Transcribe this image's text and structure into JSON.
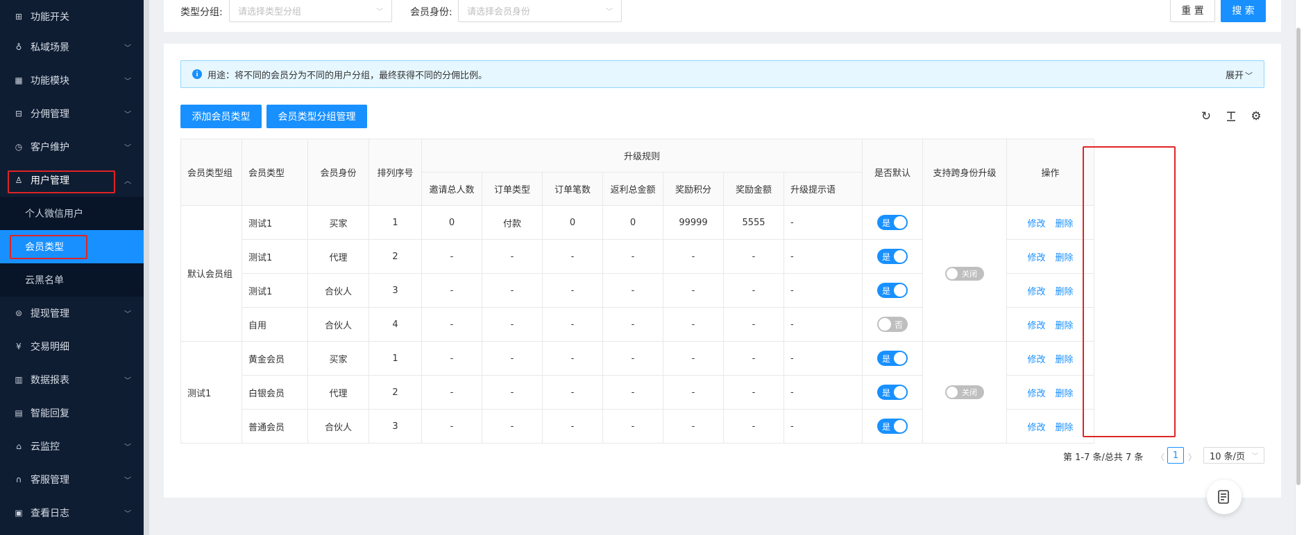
{
  "sidebar": {
    "menu": [
      {
        "label": "功能开关",
        "icon": "grid-icon",
        "chevron": false
      },
      {
        "label": "私域场景",
        "icon": "cup-icon",
        "chevron": true
      },
      {
        "label": "功能模块",
        "icon": "modules-icon",
        "chevron": true
      },
      {
        "label": "分佣管理",
        "icon": "commission-icon",
        "chevron": true
      },
      {
        "label": "客户维护",
        "icon": "clock-icon",
        "chevron": true
      },
      {
        "label": "用户管理",
        "icon": "user-icon",
        "chevron": true,
        "open": true
      },
      {
        "label": "提现管理",
        "icon": "withdraw-icon",
        "chevron": true
      },
      {
        "label": "交易明细",
        "icon": "yuan-icon",
        "chevron": false
      },
      {
        "label": "数据报表",
        "icon": "bar-chart-icon",
        "chevron": true
      },
      {
        "label": "智能回复",
        "icon": "document-icon",
        "chevron": false
      },
      {
        "label": "云监控",
        "icon": "monitor-icon",
        "chevron": true
      },
      {
        "label": "客服管理",
        "icon": "headset-icon",
        "chevron": true
      },
      {
        "label": "查看日志",
        "icon": "log-icon",
        "chevron": true
      }
    ],
    "submenu": [
      {
        "label": "个人微信用户"
      },
      {
        "label": "会员类型",
        "active": true
      },
      {
        "label": "云黑名单"
      }
    ]
  },
  "filters": {
    "group_label": "类型分组:",
    "group_placeholder": "请选择类型分组",
    "identity_label": "会员身份:",
    "identity_placeholder": "请选择会员身份",
    "reset": "重 置",
    "search": "搜 索"
  },
  "info": {
    "text": "用途：将不同的会员分为不同的用户分组，最终获得不同的分佣比例。",
    "expand": "展开"
  },
  "toolbar": {
    "add_type": "添加会员类型",
    "group_manage": "会员类型分组管理"
  },
  "table": {
    "headers": {
      "group": "会员类型组",
      "type": "会员类型",
      "identity": "会员身份",
      "order": "排列序号",
      "upgrade_rules": "升级规则",
      "invite_total": "邀请总人数",
      "order_type": "订单类型",
      "order_count": "订单笔数",
      "rebate_total": "返利总金额",
      "reward_points": "奖励积分",
      "reward_amount": "奖励金额",
      "upgrade_tip": "升级提示语",
      "is_default": "是否默认",
      "cross_upgrade": "支持跨身份升级",
      "actions": "操作"
    },
    "groups": [
      {
        "name": "默认会员组",
        "cross_upgrade": "关闭",
        "rows": [
          {
            "type": "测试1",
            "identity": "买家",
            "order": "1",
            "invite": "0",
            "order_type": "付款",
            "order_count": "0",
            "rebate": "0",
            "points": "99999",
            "amount": "5555",
            "tip": "-",
            "default_on": true,
            "default_label": "是"
          },
          {
            "type": "测试1",
            "identity": "代理",
            "order": "2",
            "invite": "-",
            "order_type": "-",
            "order_count": "-",
            "rebate": "-",
            "points": "-",
            "amount": "-",
            "tip": "-",
            "default_on": true,
            "default_label": "是"
          },
          {
            "type": "测试1",
            "identity": "合伙人",
            "order": "3",
            "invite": "-",
            "order_type": "-",
            "order_count": "-",
            "rebate": "-",
            "points": "-",
            "amount": "-",
            "tip": "-",
            "default_on": true,
            "default_label": "是"
          },
          {
            "type": "自用",
            "identity": "合伙人",
            "order": "4",
            "invite": "-",
            "order_type": "-",
            "order_count": "-",
            "rebate": "-",
            "points": "-",
            "amount": "-",
            "tip": "-",
            "default_on": false,
            "default_label": "否"
          }
        ]
      },
      {
        "name": "测试1",
        "cross_upgrade": "关闭",
        "rows": [
          {
            "type": "黄金会员",
            "identity": "买家",
            "order": "1",
            "invite": "-",
            "order_type": "-",
            "order_count": "-",
            "rebate": "-",
            "points": "-",
            "amount": "-",
            "tip": "-",
            "default_on": true,
            "default_label": "是"
          },
          {
            "type": "白银会员",
            "identity": "代理",
            "order": "2",
            "invite": "-",
            "order_type": "-",
            "order_count": "-",
            "rebate": "-",
            "points": "-",
            "amount": "-",
            "tip": "-",
            "default_on": true,
            "default_label": "是"
          },
          {
            "type": "普通会员",
            "identity": "合伙人",
            "order": "3",
            "invite": "-",
            "order_type": "-",
            "order_count": "-",
            "rebate": "-",
            "points": "-",
            "amount": "-",
            "tip": "-",
            "default_on": true,
            "default_label": "是"
          }
        ]
      }
    ],
    "edit_label": "修改",
    "delete_label": "删除"
  },
  "pagination": {
    "summary": "第 1-7 条/总共 7 条",
    "current": "1",
    "page_size": "10 条/页"
  }
}
